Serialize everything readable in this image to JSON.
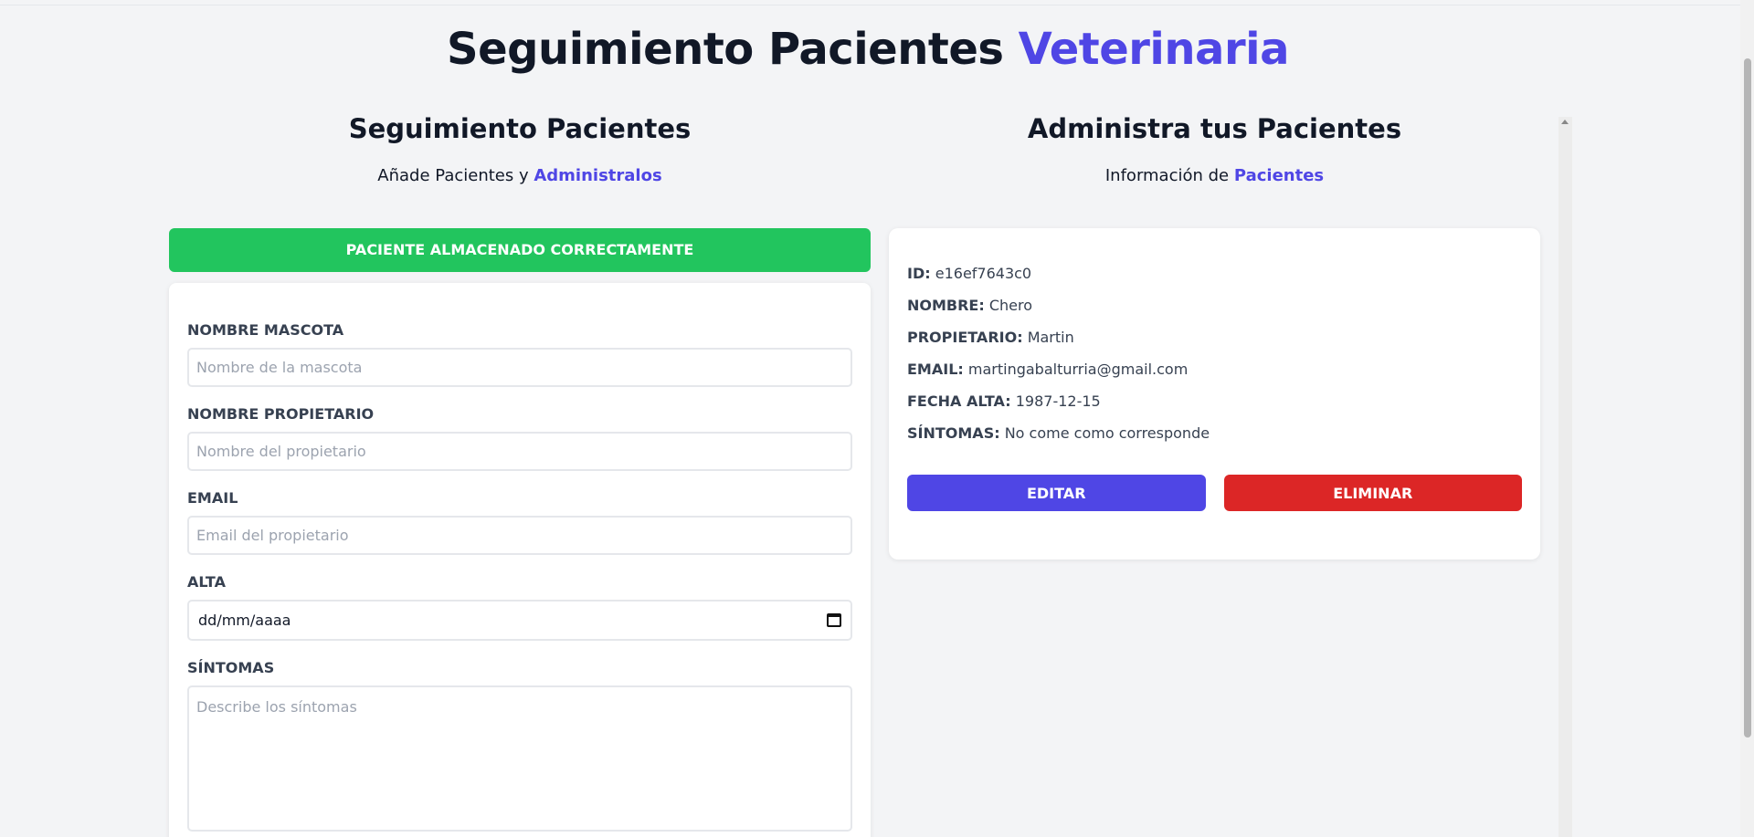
{
  "header": {
    "title_part1": "Seguimiento Pacientes",
    "title_part2": "Veterinaria"
  },
  "left": {
    "title": "Seguimiento Pacientes",
    "subtitle_prefix": "Añade Pacientes y",
    "subtitle_accent": "Administralos",
    "alert": "PACIENTE ALMACENADO CORRECTAMENTE",
    "form": {
      "pet_label": "NOMBRE MASCOTA",
      "pet_placeholder": "Nombre de la mascota",
      "owner_label": "NOMBRE PROPIETARIO",
      "owner_placeholder": "Nombre del propietario",
      "email_label": "EMAIL",
      "email_placeholder": "Email del propietario",
      "date_label": "ALTA",
      "date_value": "dd/mm/aaaa",
      "symptoms_label": "SÍNTOMAS",
      "symptoms_placeholder": "Describe los síntomas"
    }
  },
  "right": {
    "title": "Administra tus Pacientes",
    "subtitle_prefix": "Información de",
    "subtitle_accent": "Pacientes",
    "patient": {
      "id_label": "ID:",
      "id": "e16ef7643c0",
      "name_label": "NOMBRE:",
      "name": "Chero",
      "owner_label": "PROPIETARIO:",
      "owner": "Martin",
      "email_label": "EMAIL:",
      "email": "martingabalturria@gmail.com",
      "date_label": "FECHA ALTA:",
      "date": "1987-12-15",
      "symptoms_label": "SÍNTOMAS:",
      "symptoms": "No come como corresponde"
    },
    "edit_button": "EDITAR",
    "delete_button": "ELIMINAR"
  },
  "colors": {
    "accent": "#4f46e5",
    "success": "#22c55e",
    "danger": "#dc2626"
  }
}
